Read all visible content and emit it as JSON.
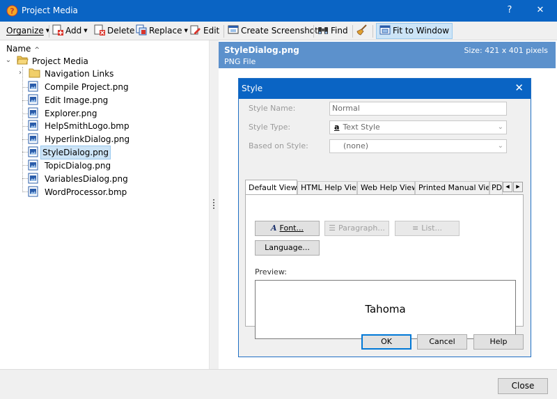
{
  "window": {
    "title": "Project Media",
    "help_glyph": "?",
    "close_glyph": "✕"
  },
  "toolbar": {
    "organize": "Organize",
    "add": "Add",
    "delete": "Delete",
    "replace": "Replace",
    "edit": "Edit",
    "create_screenshot": "Create Screenshot",
    "find": "Find",
    "fit_to_window": "Fit to Window"
  },
  "tree": {
    "column_header": "Name",
    "root": "Project Media",
    "folder": "Navigation Links",
    "files": [
      "Compile Project.png",
      "Edit Image.png",
      "Explorer.png",
      "HelpSmithLogo.bmp",
      "HyperlinkDialog.png",
      "StyleDialog.png",
      "TopicDialog.png",
      "VariablesDialog.png",
      "WordProcessor.bmp"
    ],
    "selected": "StyleDialog.png"
  },
  "info": {
    "file_name": "StyleDialog.png",
    "file_type": "PNG File",
    "size": "Size: 421 x 401 pixels"
  },
  "dialog": {
    "title": "Style",
    "close_glyph": "✕",
    "style_name_label": "Style Name:",
    "style_name_value": "Normal",
    "style_type_label": "Style Type:",
    "style_type_glyph": "a",
    "style_type_value": "Text Style",
    "based_on_label": "Based on Style:",
    "based_on_value": "(none)",
    "tabs": [
      "Default View",
      "HTML Help View",
      "Web Help View",
      "Printed Manual View",
      "PD"
    ],
    "font_button": "Font...",
    "paragraph_button": "Paragraph...",
    "list_button": "List...",
    "language_button": "Language...",
    "preview_label": "Preview:",
    "preview_text": "Tahoma",
    "ok_button": "OK",
    "cancel_button": "Cancel",
    "help_button": "Help"
  },
  "footer": {
    "close_button": "Close"
  },
  "colors": {
    "titlebar": "#0a64c4",
    "info_bar": "#5c91cc",
    "selection": "#cce4f7"
  }
}
